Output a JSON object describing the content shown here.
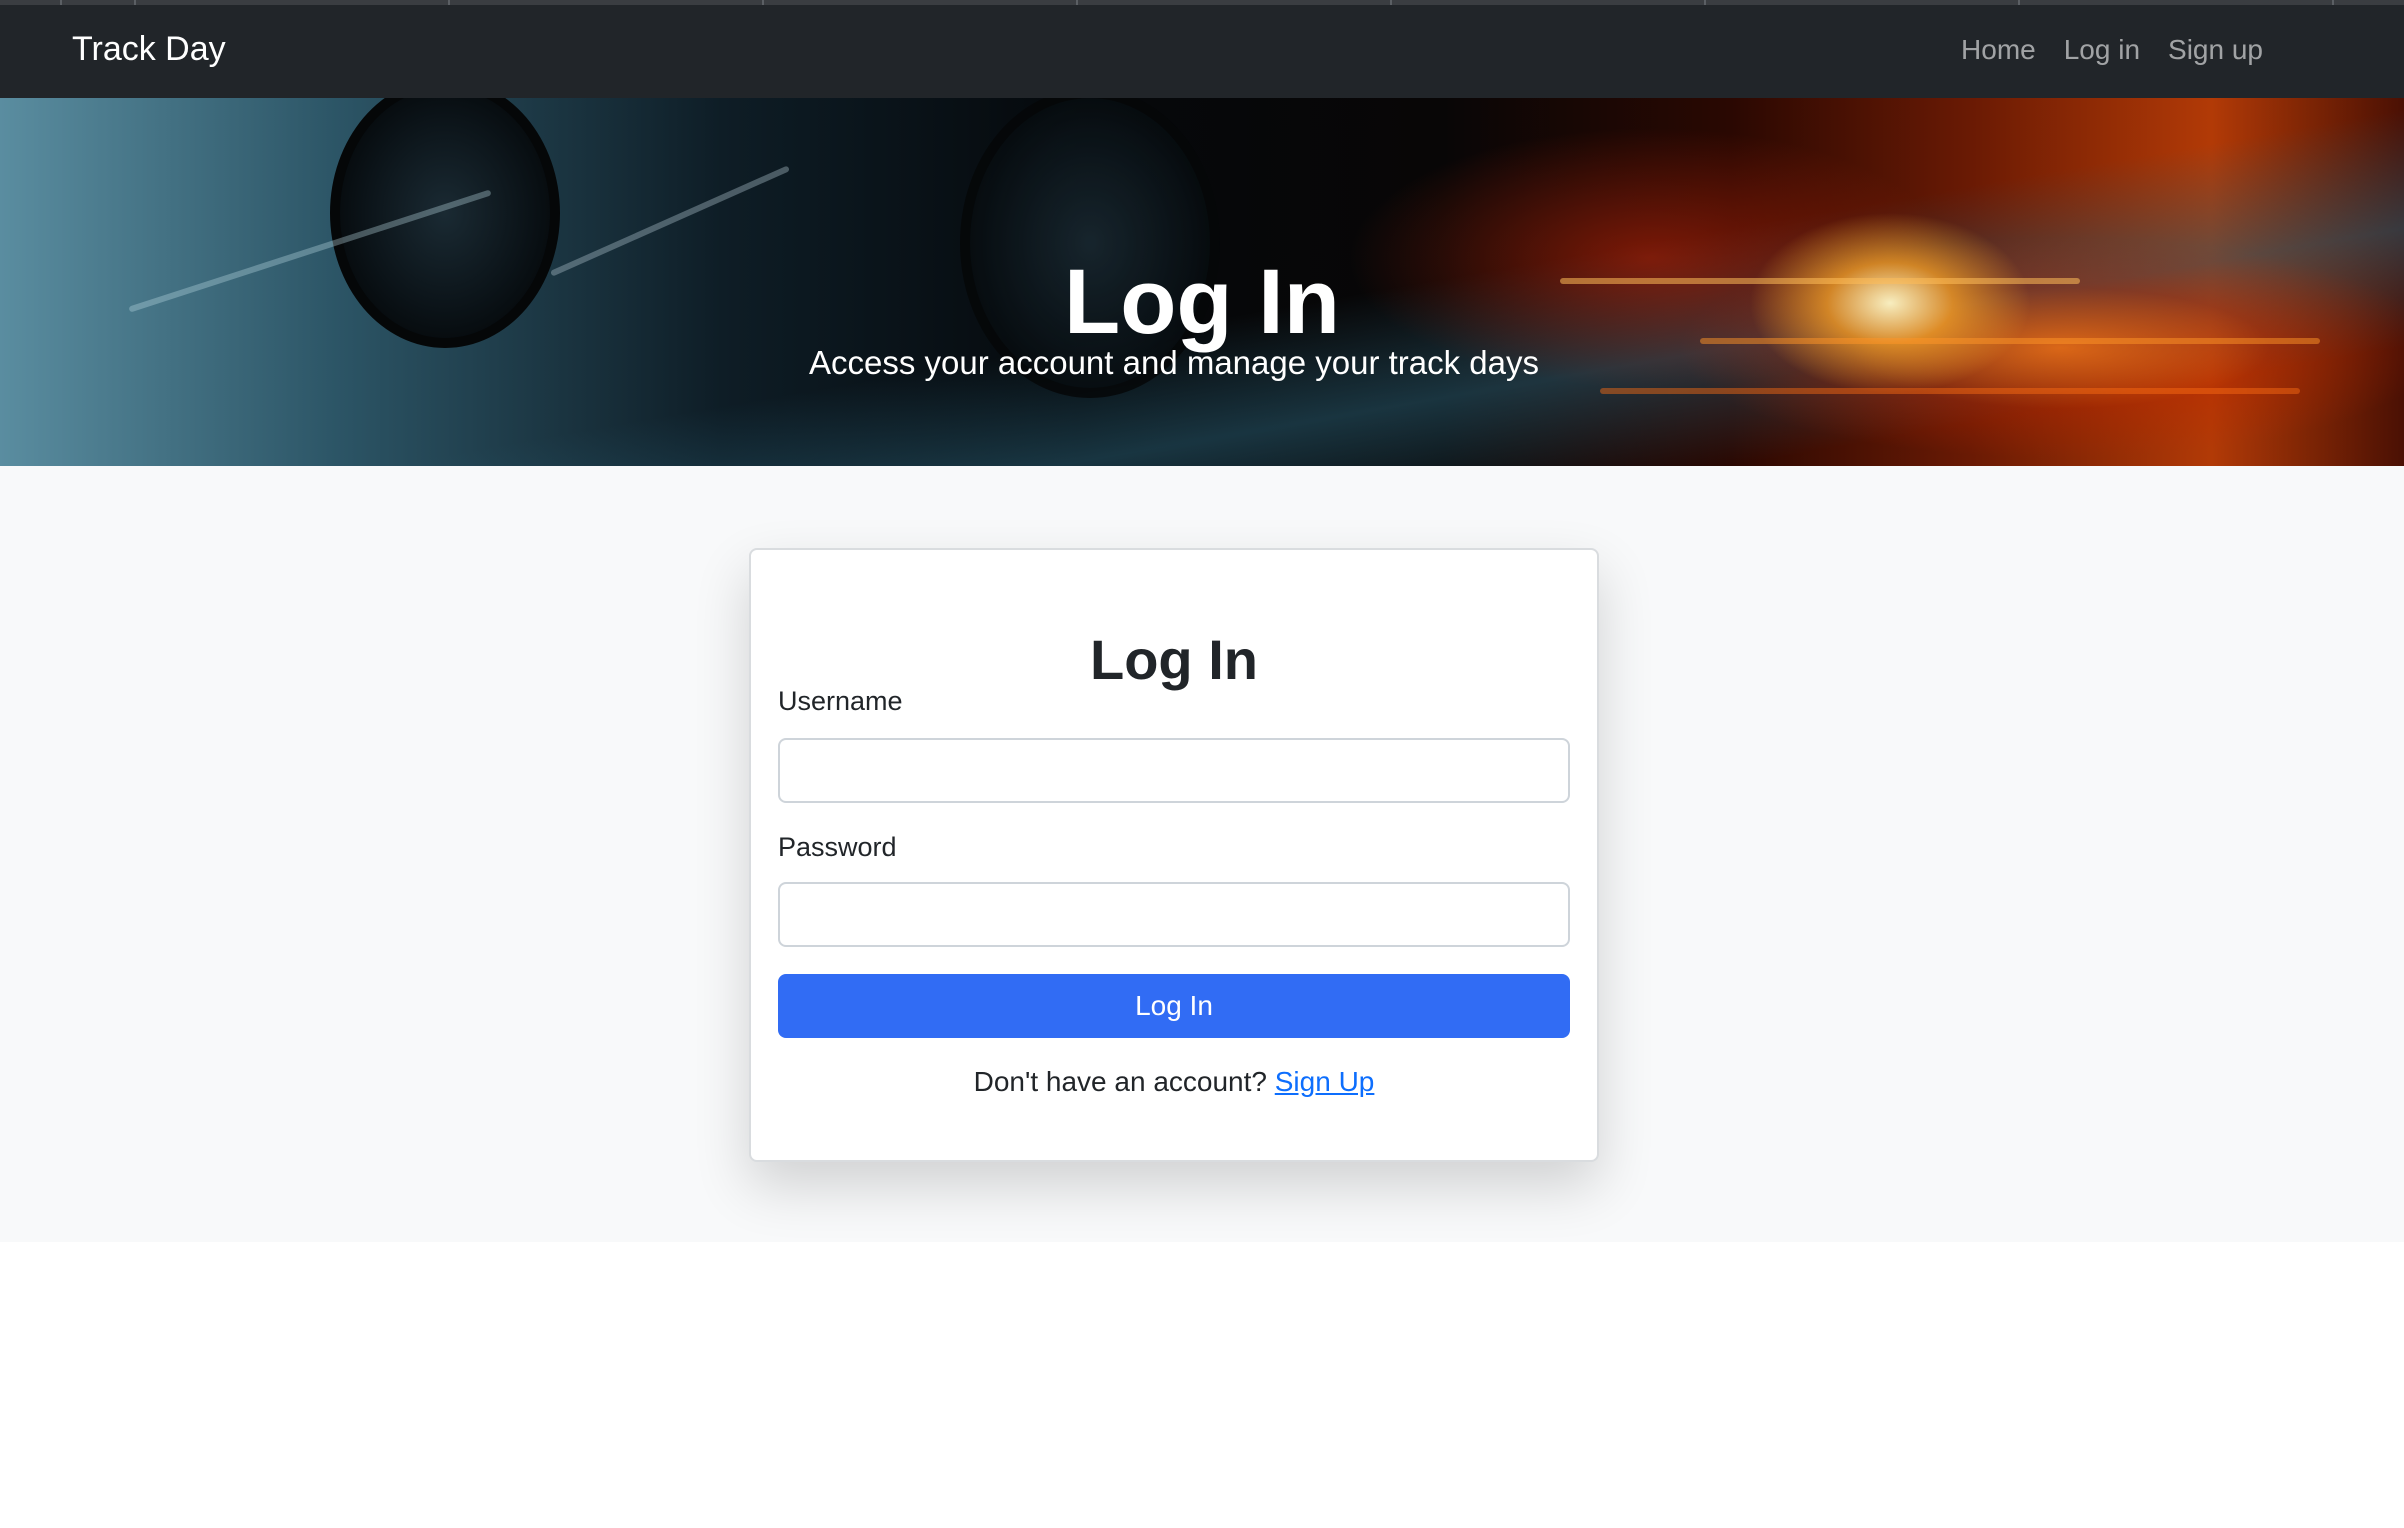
{
  "navbar": {
    "brand": "Track Day",
    "links": [
      {
        "label": "Home"
      },
      {
        "label": "Log in"
      },
      {
        "label": "Sign up"
      }
    ]
  },
  "hero": {
    "title": "Log In",
    "subtitle": "Access your account and manage your track days"
  },
  "login_form": {
    "title": "Log In",
    "username_label": "Username",
    "username_value": "",
    "password_label": "Password",
    "password_value": "",
    "submit_label": "Log In",
    "signup_prompt": "Don't have an account?",
    "signup_link": "Sign Up"
  },
  "colors": {
    "navbar_bg": "#212529",
    "primary_button": "#316cf4",
    "link": "#0d6efd",
    "page_bg": "#f8f9fa"
  }
}
